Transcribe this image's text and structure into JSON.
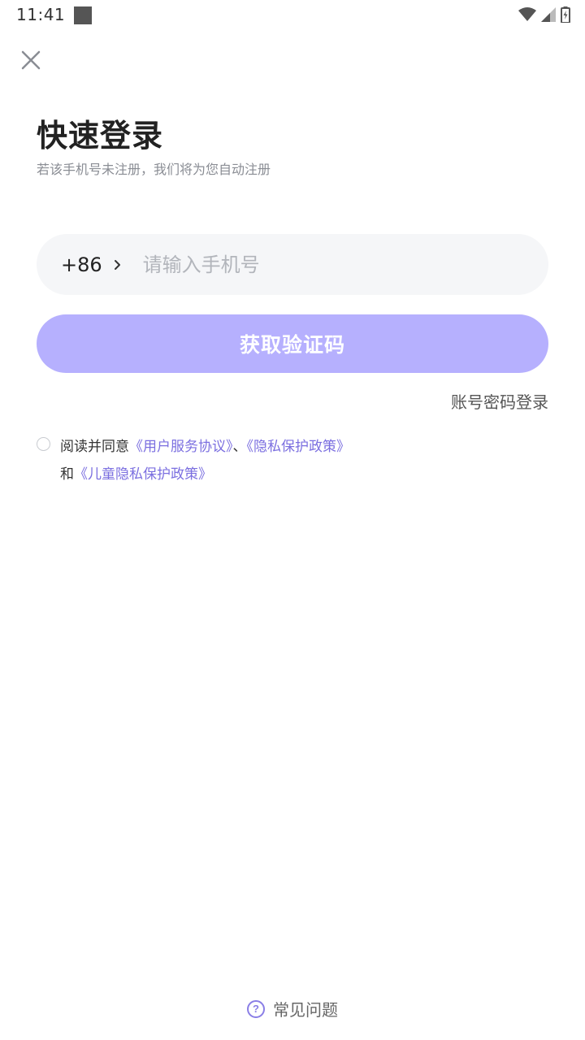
{
  "status_bar": {
    "time": "11:41"
  },
  "header": {
    "close_icon": "close-icon"
  },
  "title": "快速登录",
  "subtitle": "若该手机号未注册，我们将为您自动注册",
  "phone": {
    "country_code": "+86",
    "placeholder": "请输入手机号",
    "value": ""
  },
  "get_code_label": "获取验证码",
  "account_login_label": "账号密码登录",
  "agreement": {
    "checked": false,
    "prefix": "阅读并同意",
    "user_agreement": "《用户服务协议》",
    "separator": "、",
    "privacy_policy": "《隐私保护政策》",
    "and": "和",
    "child_privacy_policy": "《儿童隐私保护政策》"
  },
  "faq": {
    "icon_text": "?",
    "label": "常见问题"
  },
  "colors": {
    "accent": "#b6b0fe",
    "link": "#7b6fe0",
    "input_bg": "#f5f6f8"
  }
}
